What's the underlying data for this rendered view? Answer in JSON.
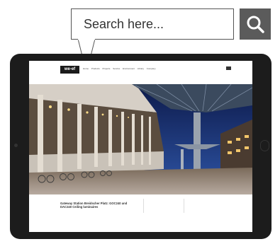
{
  "search": {
    "placeholder": "Search here..."
  },
  "icons": {
    "search_button": "search-icon"
  },
  "colors": {
    "search_button_bg": "#5b5b5b",
    "tablet_frame": "#1c1c1c"
  },
  "website": {
    "logo": "we-ef",
    "nav_items": [
      "Home",
      "Products",
      "Projects",
      "Service",
      "Environment",
      "Library",
      "Company"
    ],
    "product_title": "Gateway Station Breidscher Platz: GOC240 and DAC240 Ceiling luminaires"
  }
}
